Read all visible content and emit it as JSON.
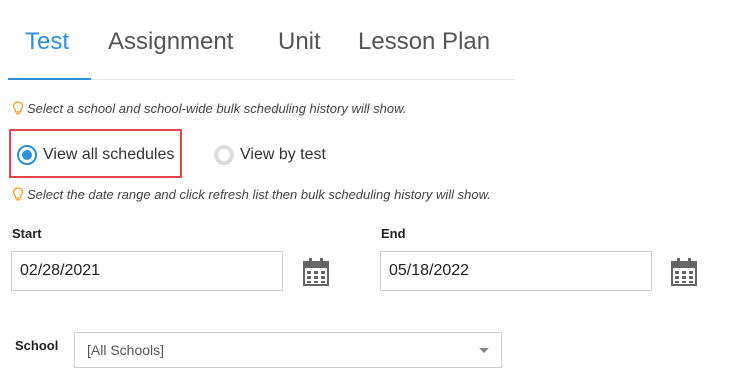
{
  "tabs": [
    {
      "label": "Test",
      "active": true
    },
    {
      "label": "Assignment",
      "active": false
    },
    {
      "label": "Unit",
      "active": false
    },
    {
      "label": "Lesson Plan",
      "active": false
    }
  ],
  "hints": {
    "school": "Select a school and school-wide bulk scheduling history will show.",
    "date": "Select the date range and click refresh list then bulk scheduling history will show."
  },
  "view_options": {
    "all_label": "View all schedules",
    "by_test_label": "View by test",
    "selected": "all"
  },
  "dates": {
    "start_label": "Start",
    "start_value": "02/28/2021",
    "end_label": "End",
    "end_value": "05/18/2022"
  },
  "school": {
    "label": "School",
    "selected": "[All Schools]"
  },
  "colors": {
    "accent": "#2f8fdc",
    "highlight": "#e0464a",
    "bulb": "#f0a02c"
  }
}
